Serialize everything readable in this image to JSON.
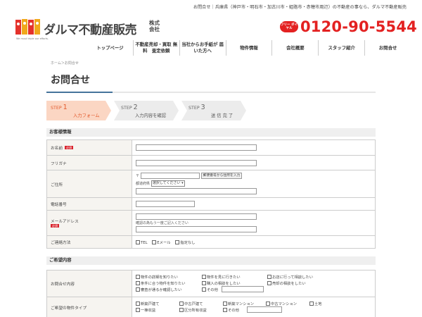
{
  "topbar": {
    "text": "お問合せ｜兵庫県（神戸市・明石市・加古川市・姫路市・赤穂市周辺）の不動産の事なら、ダルマ不動産販売"
  },
  "brand": {
    "name": "ダルマ不動産販売",
    "suffix": "株式会社",
    "tagline": "We must triple our efforts.",
    "accent": "#e32121"
  },
  "contact": {
    "badge": "フリー ダイヤル",
    "phone": "0120-90-5544"
  },
  "nav": {
    "items": [
      "トップページ",
      "不動産売却・買取 無料　査定依頼",
      "当社からお手紙が 届いた方へ",
      "物件情報",
      "会社概要",
      "スタッフ紹介",
      "お問合せ"
    ]
  },
  "breadcrumb": "ホーム＞お問合せ",
  "page": {
    "title": "お問合せ"
  },
  "steps": [
    {
      "label": "STEP",
      "num": "1",
      "sub": "入力フォーム"
    },
    {
      "label": "STEP",
      "num": "2",
      "sub": "入力内容を確認"
    },
    {
      "label": "STEP",
      "num": "3",
      "sub": "送 信 完 了"
    }
  ],
  "section1": {
    "title": "お客様情報",
    "required": "必須",
    "name": "お名前",
    "furigana": "フリガナ",
    "address": {
      "label": "ご住所",
      "zip_mark": "〒",
      "zip_button": "郵便番号から住所を入力",
      "pref_label": "都道府県",
      "pref_select": "選択してください"
    },
    "phone": "電話番号",
    "email": {
      "label": "メールアドレス",
      "confirm_note": "確認の為もう一度ご記入ください"
    },
    "method": {
      "label": "ご連絡方法",
      "options": [
        "TEL",
        "Eメール",
        "指定なし"
      ]
    }
  },
  "section2": {
    "title": "ご希望内容",
    "inquiry": {
      "label": "お問合せ内容",
      "options": [
        "物件の詳細を知りたい",
        "物件を見に行きたい",
        "お店に行って相談したい",
        "条件に合う物件を知りたい",
        "購入の相談をしたい",
        "売却の相談をしたい",
        "審査が通るか確認したい",
        "その他"
      ]
    },
    "ptype": {
      "label": "ご希望の物件タイプ",
      "options": [
        "新築戸建て",
        "中古戸建て",
        "新築マンション",
        "中古マンション",
        "土地",
        "一棟収益",
        "区分所有収益",
        "その他"
      ]
    }
  }
}
